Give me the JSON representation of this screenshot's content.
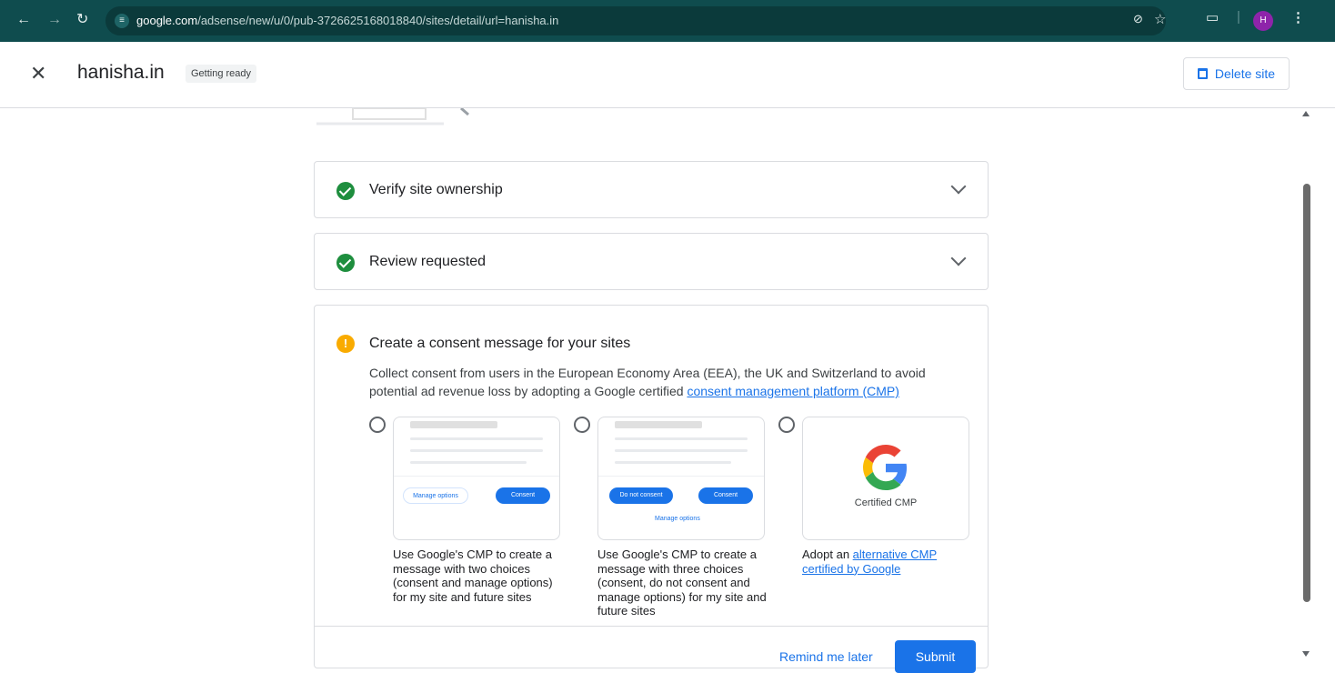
{
  "browser": {
    "back_icon": "arrow-left-icon",
    "forward_icon": "arrow-right-icon",
    "reload_icon": "reload-icon",
    "url_domain": "google.com",
    "url_path": "/adsense/new/u/0/pub-3726625168018840/sites/detail/url=hanisha.in",
    "profile_initial": "H"
  },
  "header": {
    "site_name": "hanisha.in",
    "status": "Getting ready",
    "delete_label": "Delete site"
  },
  "steps": [
    {
      "title": "Verify site ownership",
      "status": "complete"
    },
    {
      "title": "Review requested",
      "status": "complete"
    }
  ],
  "consent": {
    "title": "Create a consent message for your sites",
    "desc_text": "Collect consent from users in the European Economy Area (EEA), the UK and Switzerland to avoid potential ad revenue loss by adopting a Google certified ",
    "desc_link": "consent management platform (CMP)",
    "options": [
      {
        "manage_label": "Manage options",
        "consent_label": "Consent",
        "text": "Use Google's CMP to create a message with two choices (consent and manage options) for my site and future sites"
      },
      {
        "do_not_consent_label": "Do not consent",
        "consent_label": "Consent",
        "manage_label": "Manage options",
        "text": "Use Google's CMP to create a message with three choices (consent, do not consent and manage options) for my site and future sites"
      },
      {
        "cert_label": "Certified CMP",
        "text_prefix": "Adopt an ",
        "text_link": "alternative CMP certified by Google"
      }
    ],
    "remind_label": "Remind me later",
    "submit_label": "Submit"
  },
  "colors": {
    "browser_bar": "#0f4c4e",
    "accent": "#1a73e8",
    "success": "#1e8e3e",
    "warning": "#f9ab00"
  }
}
